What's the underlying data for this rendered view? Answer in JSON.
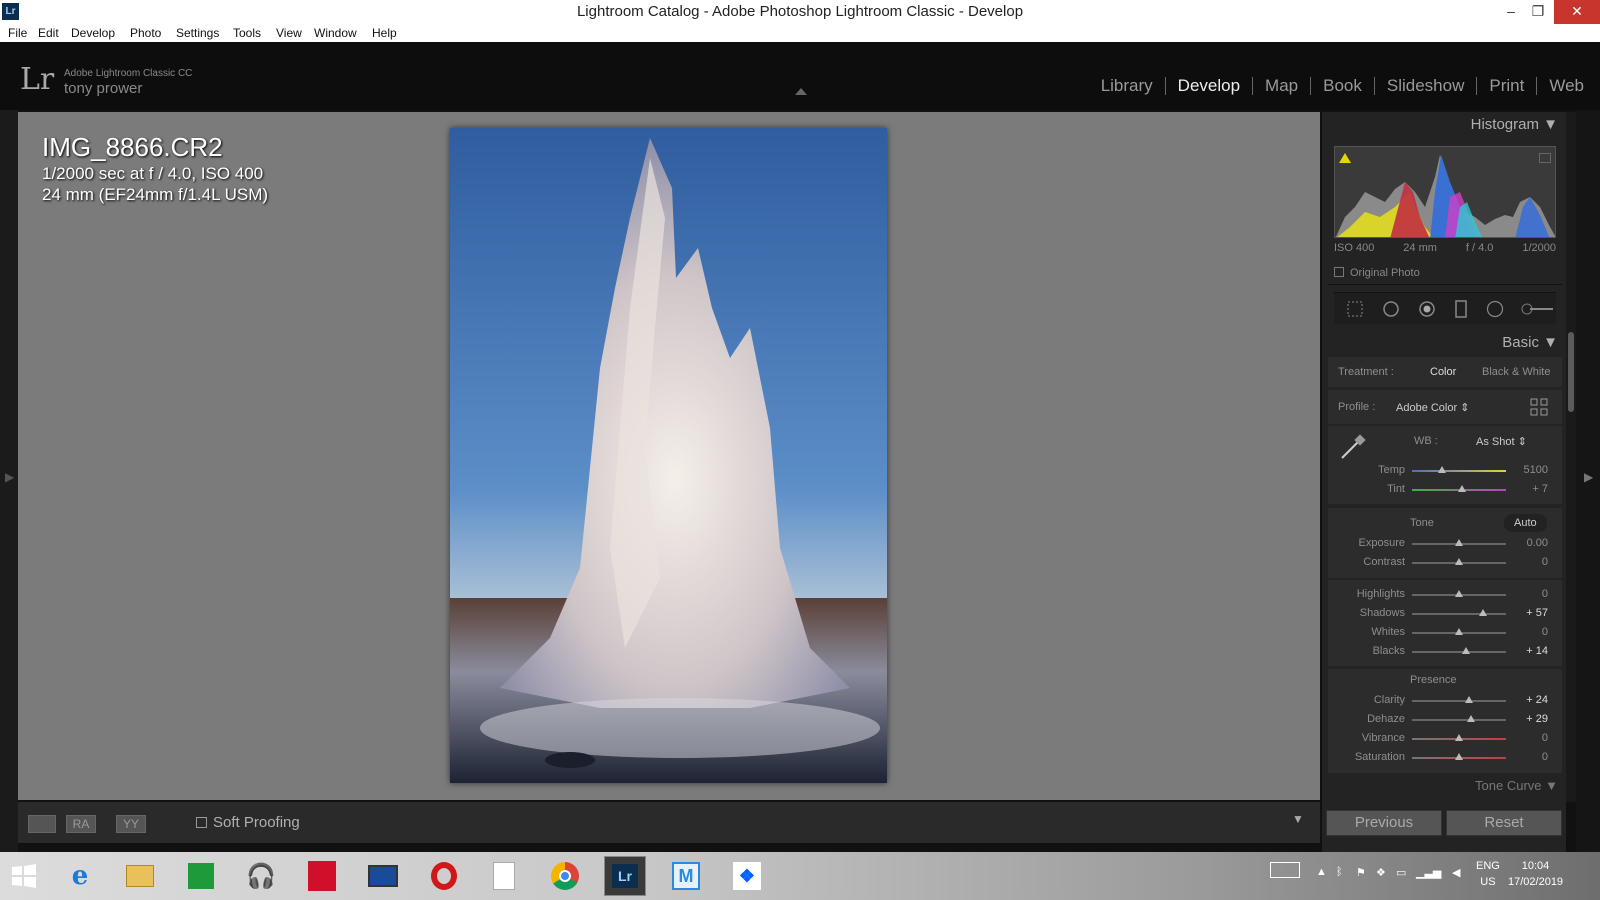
{
  "window": {
    "title": "Lightroom Catalog - Adobe Photoshop Lightroom Classic - Develop",
    "app_icon": "Lr",
    "min": "–",
    "max": "❐",
    "close": "✕"
  },
  "menu": [
    "File",
    "Edit",
    "Develop",
    "Photo",
    "Settings",
    "Tools",
    "View",
    "Window",
    "Help"
  ],
  "header": {
    "logo": "Lr",
    "brand": "Adobe Lightroom Classic CC",
    "user": "tony prower",
    "modules": [
      "Library",
      "Develop",
      "Map",
      "Book",
      "Slideshow",
      "Print",
      "Web"
    ],
    "active_module": "Develop"
  },
  "image_info": {
    "filename": "IMG_8866.CR2",
    "exposure": "1/2000 sec at f / 4.0, ISO 400",
    "lens": "24 mm (EF24mm f/1.4L USM)"
  },
  "toolbar": {
    "view_a": "RA",
    "view_b": "YY",
    "soft_proofing": "Soft Proofing"
  },
  "histogram": {
    "title": "Histogram",
    "iso": "ISO 400",
    "focal": "24 mm",
    "aperture": "f / 4.0",
    "shutter": "1/2000",
    "original_photo": "Original Photo"
  },
  "basic": {
    "title": "Basic",
    "treatment_label": "Treatment :",
    "treatment_color": "Color",
    "treatment_bw": "Black & White",
    "profile_label": "Profile :",
    "profile_value": "Adobe Color",
    "wb_label": "WB :",
    "wb_value": "As Shot",
    "tone_label": "Tone",
    "auto": "Auto",
    "presence_label": "Presence",
    "next_panel": "Tone Curve"
  },
  "sliders": {
    "temp": {
      "label": "Temp",
      "value": "5100",
      "level": 0.32
    },
    "tint": {
      "label": "Tint",
      "value": "+ 7",
      "level": 0.53
    },
    "exposure": {
      "label": "Exposure",
      "value": "0.00",
      "level": 0.5
    },
    "contrast": {
      "label": "Contrast",
      "value": "0",
      "level": 0.5
    },
    "highlights": {
      "label": "Highlights",
      "value": "0",
      "level": 0.5
    },
    "shadows": {
      "label": "Shadows",
      "value": "+ 57",
      "level": 0.76
    },
    "whites": {
      "label": "Whites",
      "value": "0",
      "level": 0.5
    },
    "blacks": {
      "label": "Blacks",
      "value": "+ 14",
      "level": 0.57
    },
    "clarity": {
      "label": "Clarity",
      "value": "+ 24",
      "level": 0.61
    },
    "dehaze": {
      "label": "Dehaze",
      "value": "+ 29",
      "level": 0.63
    },
    "vibrance": {
      "label": "Vibrance",
      "value": "0",
      "level": 0.5
    },
    "saturation": {
      "label": "Saturation",
      "value": "0",
      "level": 0.5
    }
  },
  "buttons": {
    "previous": "Previous",
    "reset": "Reset"
  },
  "taskbar": {
    "lang": "ENG",
    "region": "US",
    "time": "10:04",
    "date": "17/02/2019"
  }
}
